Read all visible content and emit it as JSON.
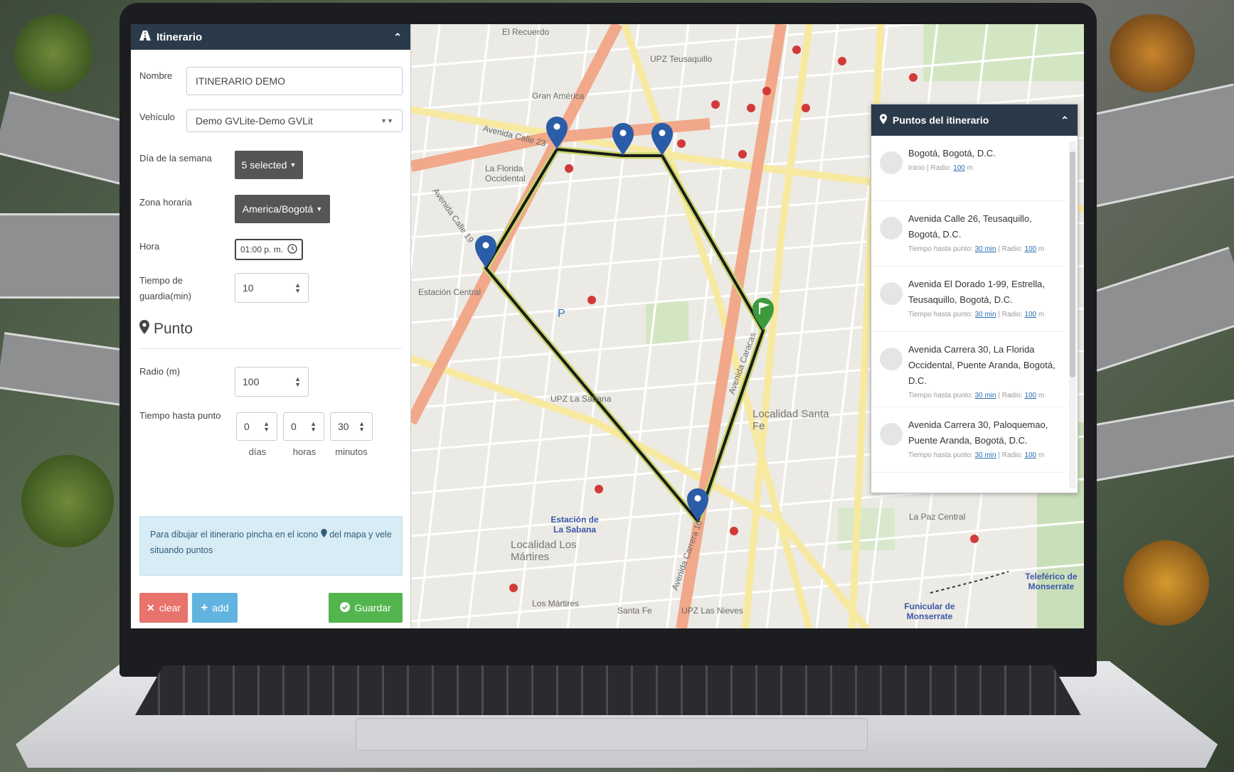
{
  "left_panel": {
    "header_title": "Itinerario",
    "fields": {
      "nombre_label": "Nombre",
      "nombre_value": "ITINERARIO DEMO",
      "vehiculo_label": "Vehículo",
      "vehiculo_value": "Demo GVLite-Demo GVLit",
      "dia_label": "Día de la semana",
      "dia_value": "5 selected",
      "zona_label": "Zona horaria",
      "zona_value": "America/Bogotá",
      "hora_label": "Hora",
      "hora_value": "01:00 p. m.",
      "tiempo_guardia_label_1": "Tiempo de",
      "tiempo_guardia_label_2": "guardia(min)",
      "tiempo_guardia_value": "10"
    },
    "punto": {
      "section_title": "Punto",
      "radio_label": "Radio (m)",
      "radio_value": "100",
      "tiempo_label": "Tiempo hasta punto",
      "dias_value": "0",
      "horas_value": "0",
      "minutos_value": "30",
      "dias_unit": "días",
      "horas_unit": "horas",
      "minutos_unit": "minutos"
    },
    "info_text_1": "Para dibujar el itinerario pincha en el icono",
    "info_text_2": "del mapa y vele",
    "info_text_3": "situando puntos",
    "buttons": {
      "clear": "clear",
      "add": "add",
      "guardar": "Guardar"
    },
    "colors": {
      "header": "#2b3a4a",
      "clear": "#e8726c",
      "add": "#62b4e0",
      "guardar": "#52b54e",
      "dark": "#555555"
    }
  },
  "map": {
    "labels": [
      {
        "text": "El Recuerdo"
      },
      {
        "text": "Gran América"
      },
      {
        "text": "UPZ Teusaquillo"
      },
      {
        "text": "Avenida Calle 23"
      },
      {
        "text": "La Florida Occidental"
      },
      {
        "text": "Estación Central"
      },
      {
        "text": "UPZ La Sabana"
      },
      {
        "text": "Localidad Santa Fe"
      },
      {
        "text": "Localidad Los Mártires"
      },
      {
        "text": "Los Mártires"
      },
      {
        "text": "UPZ Las Nieves"
      },
      {
        "text": "La Paz Central"
      },
      {
        "text": "Santa Fe"
      },
      {
        "text": "Avenida Carrera 10"
      },
      {
        "text": "Avenida Calle 19"
      },
      {
        "text": "Avenida Caracas"
      },
      {
        "text": "Teleférico de Monserrate"
      },
      {
        "text": "Funicular de Monserrate"
      }
    ],
    "station_label": "Estación de La Sabana",
    "colors": {
      "route": "#1a1a1a",
      "marker": "#2a5ca8",
      "flag": "#3c9a3c",
      "poi": "#d23a3a",
      "main_road": "#f2a88a",
      "secondary_road": "#f7e9a0",
      "park": "#c9dfb9"
    }
  },
  "points_panel": {
    "header_title": "Puntos del itinerario",
    "items": [
      {
        "address": "Bogotá, Bogotá, D.C.",
        "meta_a": "Inicio | Radio:",
        "meta_b": "",
        "radio": "100",
        "unit": "m"
      },
      {
        "address": "Avenida Calle 26, Teusaquillo, Bogotá, D.C.",
        "meta_a": "Tiempo hasta punto:",
        "meta_b": "Radio:",
        "tiempo": "30 min",
        "radio": "100",
        "unit": "m"
      },
      {
        "address": "Avenida El Dorado 1-99, Estrella, Teusaquillo, Bogotá, D.C.",
        "meta_a": "Tiempo hasta punto:",
        "meta_b": "Radio:",
        "tiempo": "30 min",
        "radio": "100",
        "unit": "m"
      },
      {
        "address": "Avenida Carrera 30, La Florida Occidental, Puente Aranda, Bogotá, D.C.",
        "meta_a": "Tiempo hasta punto:",
        "meta_b": "Radio:",
        "tiempo": "30 min",
        "radio": "100",
        "unit": "m"
      },
      {
        "address": "Avenida Carrera 30, Paloquemao, Puente Aranda, Bogotá, D.C.",
        "meta_a": "Tiempo hasta punto:",
        "meta_b": "Radio:",
        "tiempo": "30 min",
        "radio": "100",
        "unit": "m"
      }
    ]
  }
}
